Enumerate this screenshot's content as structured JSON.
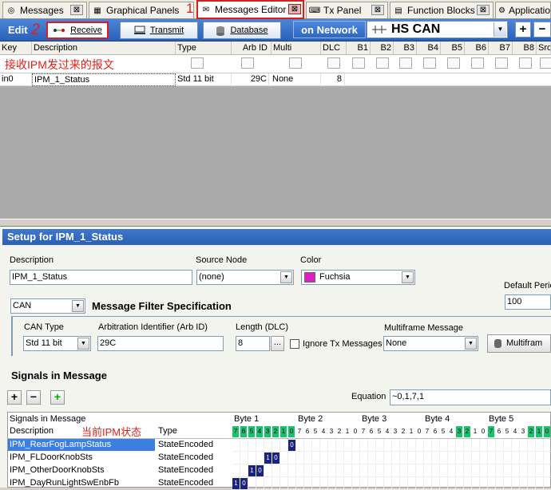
{
  "tabs": [
    {
      "label": "Messages",
      "icon": "messages-icon",
      "close": "⊠"
    },
    {
      "label": "Graphical Panels",
      "icon": "panels-icon",
      "close": "⊠"
    },
    {
      "label": "Messages Editor",
      "icon": "messages-editor-icon",
      "close": "⊠"
    },
    {
      "label": "Tx Panel",
      "icon": "tx-panel-icon",
      "close": "⊠"
    },
    {
      "label": "Function Blocks",
      "icon": "function-blocks-icon",
      "close": "⊠"
    },
    {
      "label": "Applicatio",
      "icon": "application-icon",
      "close": ""
    }
  ],
  "annotations": {
    "one": "1",
    "two": "2",
    "grid_note": "接收IPM发过来的报文",
    "signals_note": "当前IPM状态"
  },
  "toolbar": {
    "edit": "Edit",
    "receive": "Receive",
    "transmit": "Transmit",
    "database": "Database",
    "on_network": "on Network",
    "network": "HS CAN",
    "add": "+",
    "remove": "−"
  },
  "grid": {
    "headers": [
      "Key",
      "Description",
      "Type",
      "Arb ID",
      "Multi",
      "DLC",
      "B1",
      "B2",
      "B3",
      "B4",
      "B5",
      "B6",
      "B7",
      "B8",
      "Src"
    ],
    "row": {
      "key": "in0",
      "description": "IPM_1_Status",
      "type": "Std 11 bit",
      "arb_id": "29C",
      "multi": "None",
      "dlc": "8"
    }
  },
  "setup": {
    "title": "Setup for IPM_1_Status",
    "description_label": "Description",
    "description_value": "IPM_1_Status",
    "source_label": "Source Node",
    "source_value": "(none)",
    "color_label": "Color",
    "color_value": "Fuchsia",
    "color_hex": "#e01ec8",
    "period_label": "Default Perio",
    "period_value": "100",
    "protocol_value": "CAN",
    "filter_heading": "Message Filter Specification",
    "can_type_label": "CAN Type",
    "can_type_value": "Std 11 bit",
    "arb_label": "Arbitration Identifier (Arb ID)",
    "arb_value": "29C",
    "length_label": "Length (DLC)",
    "length_value": "8",
    "length_btn": "...",
    "ignore_label": "Ignore Tx Messages",
    "multiframe_label": "Multiframe Message",
    "multiframe_value": "None",
    "multiframe_btn": "Multifram",
    "signals_heading": "Signals in Message",
    "equation_label": "Equation",
    "equation_value": "~0,1,7,1",
    "sig_buttons": [
      "+",
      "−",
      "+"
    ]
  },
  "signals": {
    "header1": "Signals in Message",
    "header_desc": "Description",
    "header_type": "Type",
    "bytes": [
      "Byte 1",
      "Byte 2",
      "Byte 3",
      "Byte 4",
      "Byte 5"
    ],
    "rows": [
      {
        "name": "IPM_RearFogLampStatus",
        "type": "StateEncoded",
        "bits": "0"
      },
      {
        "name": "IPM_FLDoorKnobSts",
        "type": "StateEncoded",
        "bits": "1 0"
      },
      {
        "name": "IPM_OtherDoorKnobSts",
        "type": "StateEncoded",
        "bits": "1 0"
      },
      {
        "name": "IPM_DayRunLightSwEnbFb",
        "type": "StateEncoded",
        "bits": "1 0"
      }
    ]
  }
}
